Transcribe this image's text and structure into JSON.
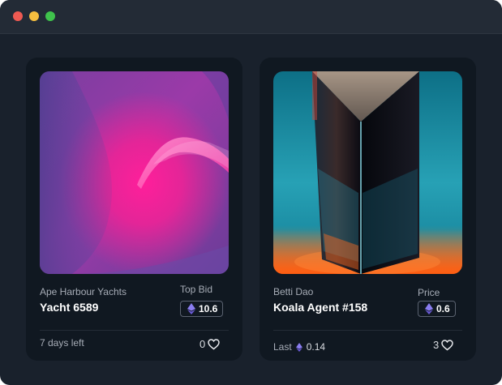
{
  "colors": {
    "window_bg": "#19212c",
    "titlebar": "#232b36",
    "card_bg": "#101821",
    "eth": "#7b6cd9"
  },
  "window": {
    "traffic_lights": [
      "close",
      "minimize",
      "maximize"
    ]
  },
  "cards": [
    {
      "collection": "Ape Harbour Yachts",
      "title": "Yacht 6589",
      "price_label": "Top Bid",
      "price": "10.6",
      "price_icon": "eth-icon",
      "footer_left": "7 days left",
      "likes": "0"
    },
    {
      "collection": "Betti Dao",
      "title": "Koala Agent #158",
      "price_label": "Price",
      "price": "0.6",
      "price_icon": "eth-icon",
      "footer_last_label": "Last",
      "footer_last_value": "0.14",
      "likes": "3"
    }
  ]
}
